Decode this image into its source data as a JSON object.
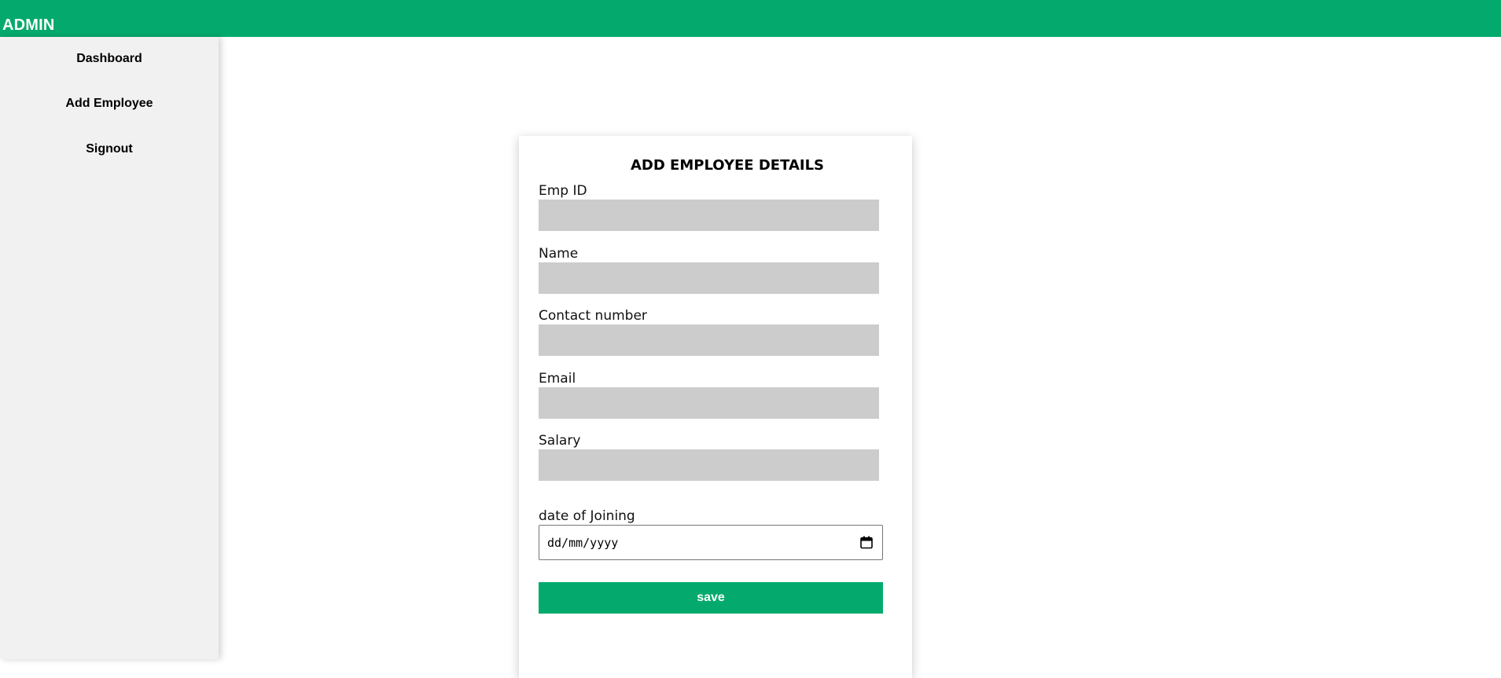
{
  "header": {
    "brand": "ADMIN",
    "bar_color": "#04aa6d"
  },
  "sidebar": {
    "items": [
      {
        "label": "Dashboard"
      },
      {
        "label": "Add Employee"
      },
      {
        "label": "Signout"
      }
    ]
  },
  "form": {
    "title": "ADD EMPLOYEE DETAILS",
    "fields": [
      {
        "label": "Emp ID",
        "value": ""
      },
      {
        "label": "Name",
        "value": ""
      },
      {
        "label": "Contact number",
        "value": ""
      },
      {
        "label": "Email",
        "value": ""
      },
      {
        "label": "Salary",
        "value": ""
      }
    ],
    "date_field": {
      "label": "date of Joining",
      "placeholder": "dd/mm/yyyy",
      "icon": "calendar-icon"
    },
    "save_label": "save",
    "accent_color": "#04aa6d"
  }
}
